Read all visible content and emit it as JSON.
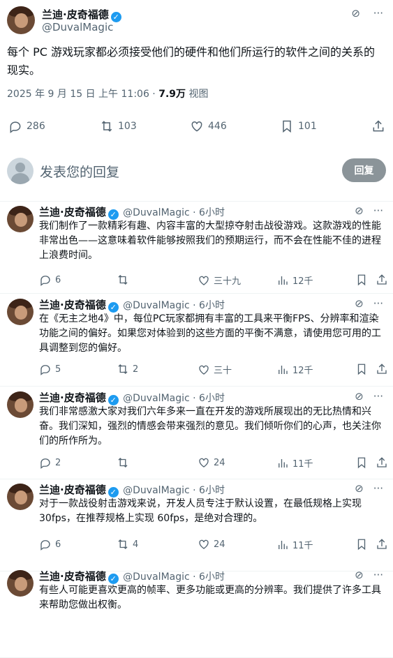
{
  "post": {
    "author_name": "兰迪·皮奇福德",
    "handle": "@DuvalMagic",
    "text": "每个 PC 游戏玩家都必须接受他们的硬件和他们所运行的软件之间的关系的现实。",
    "date": "2025 年 9 月 15 日 上午 11:06",
    "separator": " · ",
    "views": "7.9万",
    "views_label": " 视图",
    "stats": {
      "replies": "286",
      "reposts": "103",
      "likes": "446",
      "bookmarks": "101"
    },
    "icons": {
      "grok": "grok-icon",
      "more": "more-icon",
      "share": "share-icon"
    }
  },
  "reply_box": {
    "placeholder": "发表您的回复",
    "button": "回复"
  },
  "replies": [
    {
      "name": "兰迪·皮奇福德",
      "handle": "@DuvalMagic · 6小时",
      "text": "我们制作了一款精彩有趣、内容丰富的大型掠夺射击战役游戏。这款游戏的性能非常出色——这意味着软件能够按照我们的预期运行，而不会在性能不佳的进程上浪费时间。",
      "replies": "6",
      "reposts": "",
      "likes": "三十九",
      "views": "12千"
    },
    {
      "name": "兰迪·皮奇福德",
      "handle": "@DuvalMagic · 6小时",
      "text": "在《无主之地4》中，每位PC玩家都拥有丰富的工具来平衡FPS、分辨率和渲染功能之间的偏好。如果您对体验到的这些方面的平衡不满意，请使用您可用的工具调整到您的偏好。",
      "replies": "5",
      "reposts": "2",
      "likes": "三十",
      "views": "12千"
    },
    {
      "name": "兰迪·皮奇福德",
      "handle": "@DuvalMagic · 6小时",
      "text": "我们非常感激大家对我们六年多来一直在开发的游戏所展现出的无比热情和兴奋。我们深知，强烈的情感会带来强烈的意见。我们倾听你们的心声，也关注你们的所作所为。",
      "replies": "2",
      "reposts": "",
      "likes": "24",
      "views": "11千"
    },
    {
      "name": "兰迪·皮奇福德",
      "handle": "@DuvalMagic · 6小时",
      "text": "对于一款战役射击游戏来说，开发人员专注于默认设置，在最低规格上实现 30fps，在推荐规格上实现 60fps，是绝对合理的。",
      "replies": "6",
      "reposts": "4",
      "likes": "24",
      "views": "11千"
    },
    {
      "name": "兰迪·皮奇福德",
      "handle": "@DuvalMagic · 6小时",
      "text": "有些人可能更喜欢更高的帧率、更多功能或更高的分辨率。我们提供了许多工具来帮助您做出权衡。",
      "replies": "",
      "reposts": "",
      "likes": "",
      "views": ""
    }
  ],
  "colors": {
    "verified": "#1d9bf0",
    "text": "#0f1419",
    "muted": "#536471",
    "reply_button": "#8b9499"
  }
}
